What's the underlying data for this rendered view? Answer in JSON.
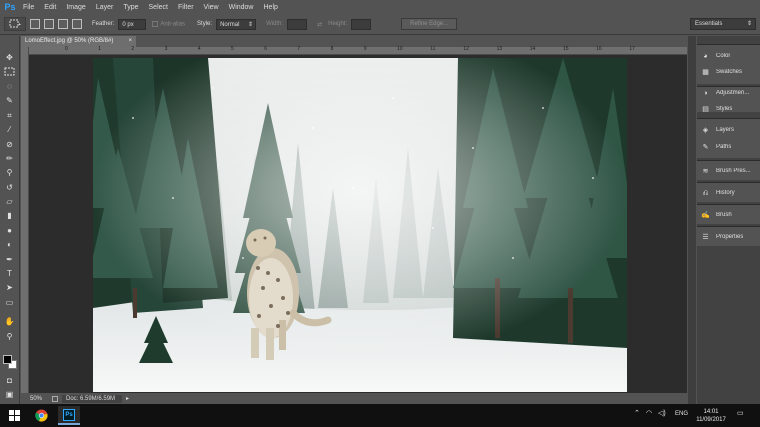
{
  "app": {
    "logo": "Ps"
  },
  "menu": [
    "File",
    "Edit",
    "Image",
    "Layer",
    "Type",
    "Select",
    "Filter",
    "View",
    "Window",
    "Help"
  ],
  "options": {
    "feather_label": "Feather:",
    "feather_value": "0 px",
    "antialias_label": "Anti-alias",
    "style_label": "Style:",
    "style_value": "Normal",
    "width_label": "Width:",
    "height_label": "Height:",
    "refine_label": "Refine Edge..."
  },
  "workspace": "Essentials",
  "document": {
    "tab_title": "LomoEffect.jpg @ 50% (RGB/8#)",
    "ruler_marks": [
      "0",
      "1",
      "2",
      "3",
      "4",
      "5",
      "6",
      "7",
      "8",
      "9",
      "10",
      "11",
      "12",
      "13",
      "14",
      "15",
      "16",
      "17"
    ],
    "zoom": "50%",
    "doc_size": "Doc: 6.59M/6.59M"
  },
  "panels": {
    "color": "Color",
    "swatches": "Swatches",
    "adjustments": "Adjustmen...",
    "styles": "Styles",
    "layers": "Layers",
    "paths": "Paths",
    "brush_presets": "Brush Pres...",
    "history": "History",
    "brush": "Brush",
    "properties": "Properties"
  },
  "taskbar": {
    "language": "ENG",
    "time": "14:01",
    "date": "11/09/2017",
    "ps_label": "Ps"
  },
  "colors": {
    "accent": "#2fa4ff",
    "ui_bg": "#535353",
    "canvas_bg": "#2c2c2c"
  }
}
